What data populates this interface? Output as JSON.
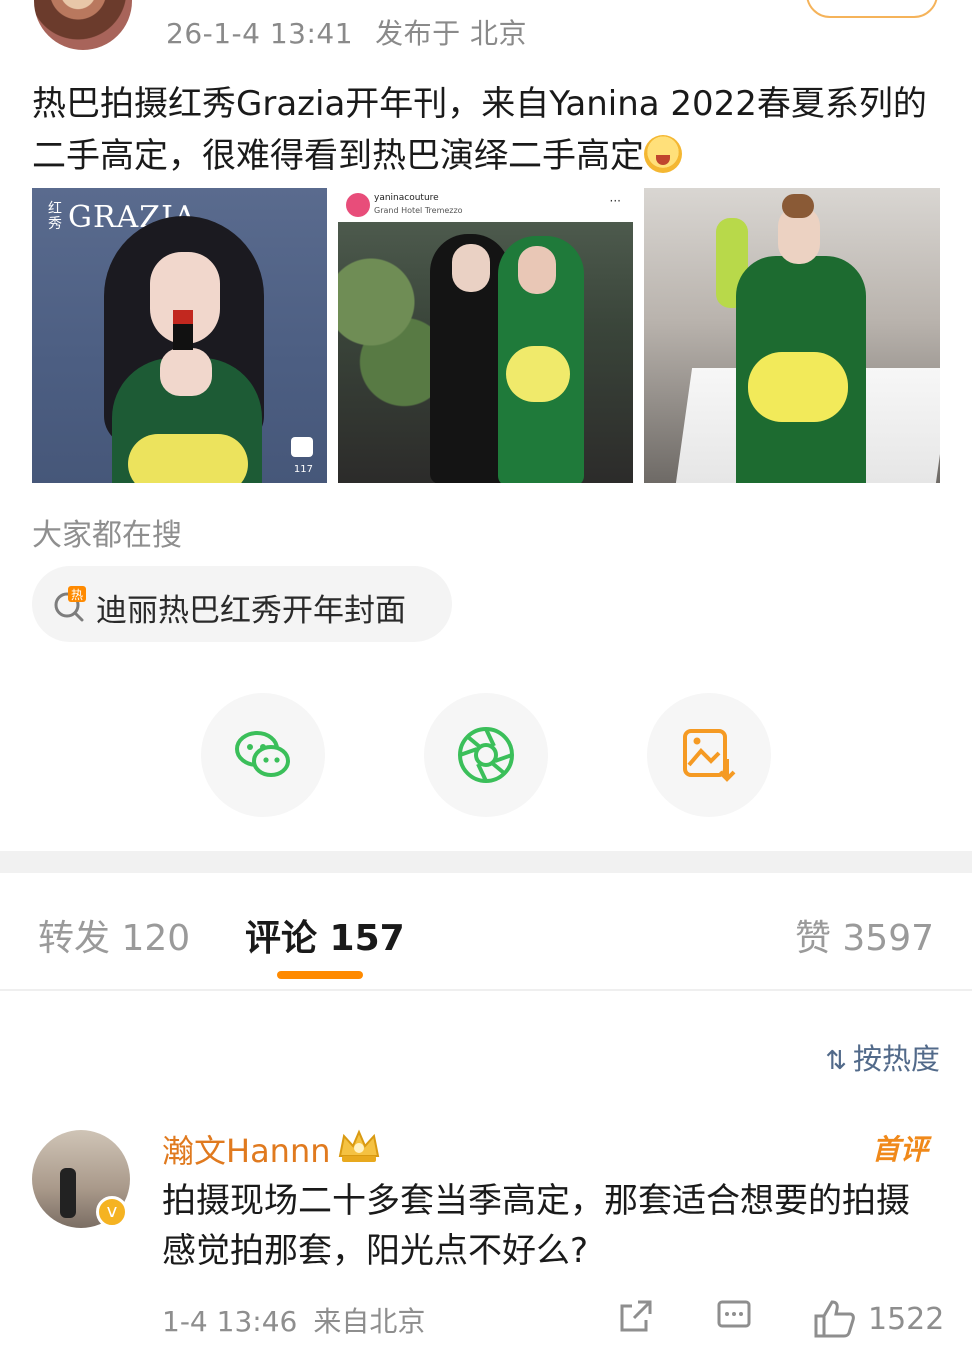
{
  "post": {
    "time": "26-1-4 13:41",
    "location": "发布于 北京",
    "text": "热巴拍摄红秀Grazia开年刊，来自Yanina 2022春夏系列的二手高定，很难得看到热巴演绎二手高定",
    "emoji": "laugh-emoji"
  },
  "images": {
    "img1": {
      "brand": "GRAZIA",
      "brand_cn": "红秀",
      "like_count": "117"
    },
    "img2": {
      "account": "yaninacouture",
      "subtitle": "Grand Hotel Tremezzo",
      "more": "···"
    }
  },
  "search": {
    "title": "大家都在搜",
    "chip": "迪丽热巴红秀开年封面",
    "chip_icon": "hot-search-icon"
  },
  "share": {
    "items": [
      {
        "name": "wechat",
        "icon": "wechat-icon",
        "color": "#3bbf5a"
      },
      {
        "name": "moments",
        "icon": "moments-icon",
        "color": "#3bbf5a"
      },
      {
        "name": "save-image",
        "icon": "save-image-icon",
        "color": "#f59a23"
      }
    ]
  },
  "tabs": {
    "repost": "转发 120",
    "comments": "评论 157",
    "likes": "赞 3597",
    "active_color": "#ff8a00"
  },
  "sort": {
    "label": "按热度",
    "icon": "sort-icon"
  },
  "comment": {
    "author": "瀚文Hannn",
    "badge": "首评",
    "verified": "v",
    "text": "拍摄现场二十多套当季高定，那套适合想要的拍摄感觉拍那套，阳光点不好么?",
    "date": "1-4 13:46",
    "source": "来自北京",
    "like_count": "1522",
    "name_color": "#e07a1f"
  }
}
